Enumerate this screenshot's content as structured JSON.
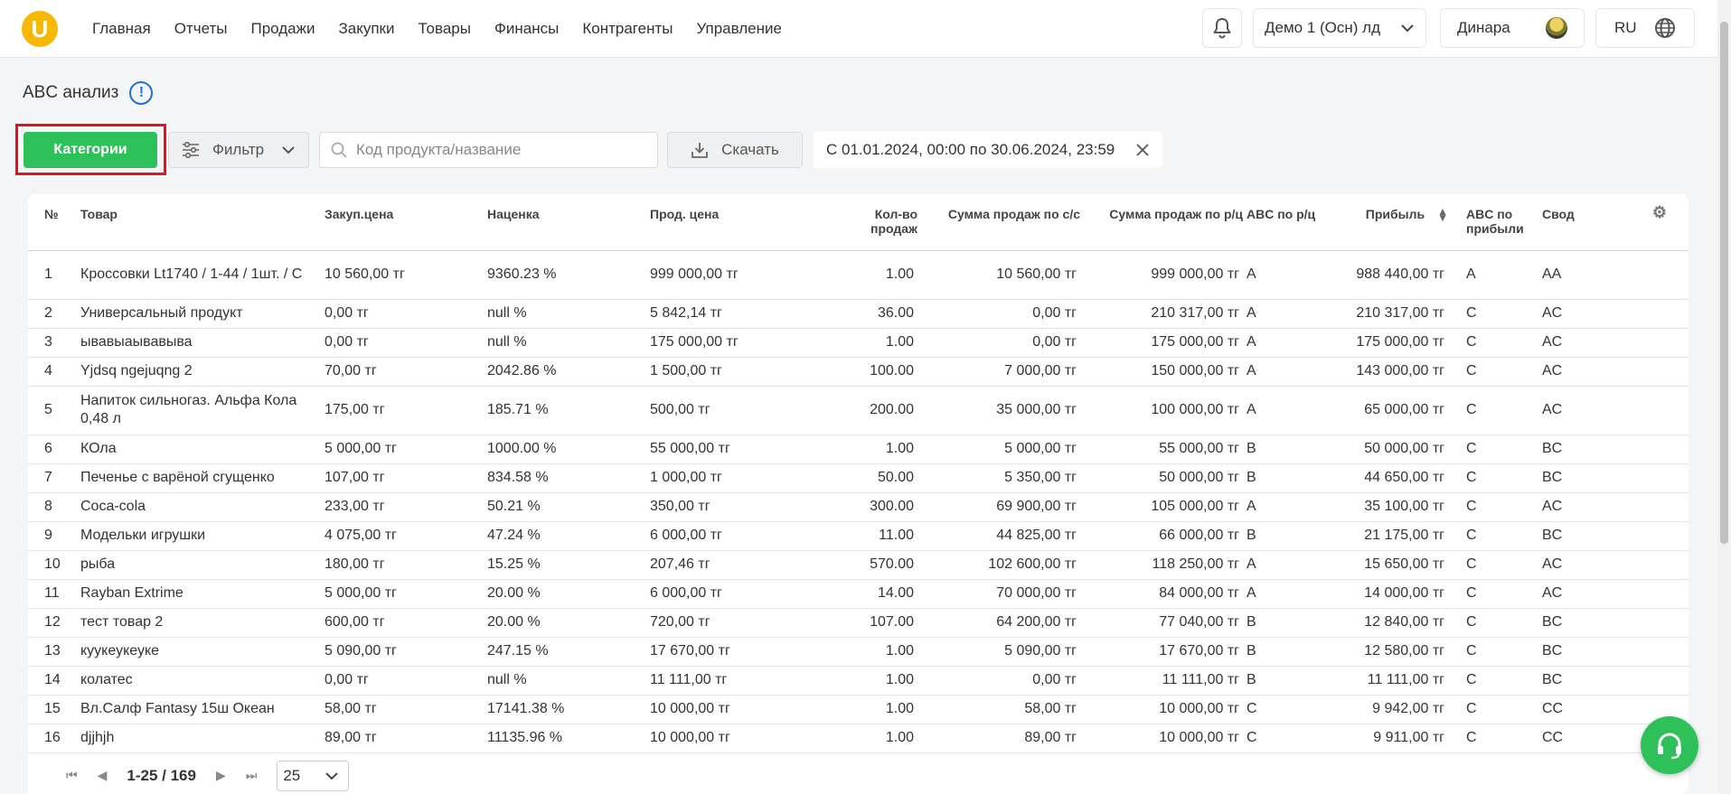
{
  "header": {
    "logo_letter": "U",
    "nav": [
      "Главная",
      "Отчеты",
      "Продажи",
      "Закупки",
      "Товары",
      "Финансы",
      "Контрагенты",
      "Управление"
    ],
    "org_selector": "Демо 1 (Осн) лд",
    "user_name": "Динара",
    "language": "RU"
  },
  "page": {
    "title": "ABC анализ",
    "info_glyph": "!"
  },
  "toolbar": {
    "categories_label": "Категории",
    "filter_label": "Фильтр",
    "search_placeholder": "Код продукта/название",
    "search_value": "",
    "download_label": "Скачать",
    "date_range": "С 01.01.2024, 00:00 по 30.06.2024, 23:59"
  },
  "table": {
    "columns": [
      "№",
      "Товар",
      "Закуп.цена",
      "Наценка",
      "Прод. цена",
      "Кол-во продаж",
      "Сумма продаж по с/с",
      "Сумма продаж по р/ц",
      "ABC по р/ц",
      "Прибыль",
      "ABC по прибыли",
      "Свод"
    ],
    "rows": [
      [
        "1",
        "Кроссовки Lt1740 / 1-44 / 1шт. / C",
        "10 560,00 тг",
        "9360.23 %",
        "999 000,00 тг",
        "1.00",
        "10 560,00 тг",
        "999 000,00 тг",
        "A",
        "988 440,00 тг",
        "A",
        "AA"
      ],
      [
        "2",
        "Универсальный продукт",
        "0,00 тг",
        "null %",
        "5 842,14 тг",
        "36.00",
        "0,00 тг",
        "210 317,00 тг",
        "A",
        "210 317,00 тг",
        "C",
        "AC"
      ],
      [
        "3",
        "ывавыаывавыва",
        "0,00 тг",
        "null %",
        "175 000,00 тг",
        "1.00",
        "0,00 тг",
        "175 000,00 тг",
        "A",
        "175 000,00 тг",
        "C",
        "AC"
      ],
      [
        "4",
        "Yjdsq ngejuqng 2",
        "70,00 тг",
        "2042.86 %",
        "1 500,00 тг",
        "100.00",
        "7 000,00 тг",
        "150 000,00 тг",
        "A",
        "143 000,00 тг",
        "C",
        "AC"
      ],
      [
        "5",
        "Напиток сильногаз. Альфа Кола 0,48 л",
        "175,00 тг",
        "185.71 %",
        "500,00 тг",
        "200.00",
        "35 000,00 тг",
        "100 000,00 тг",
        "A",
        "65 000,00 тг",
        "C",
        "AC"
      ],
      [
        "6",
        "КОла",
        "5 000,00 тг",
        "1000.00 %",
        "55 000,00 тг",
        "1.00",
        "5 000,00 тг",
        "55 000,00 тг",
        "B",
        "50 000,00 тг",
        "C",
        "BC"
      ],
      [
        "7",
        "Печенье с варёной сгущенко",
        "107,00 тг",
        "834.58 %",
        "1 000,00 тг",
        "50.00",
        "5 350,00 тг",
        "50 000,00 тг",
        "B",
        "44 650,00 тг",
        "C",
        "BC"
      ],
      [
        "8",
        "Coca-cola",
        "233,00 тг",
        "50.21 %",
        "350,00 тг",
        "300.00",
        "69 900,00 тг",
        "105 000,00 тг",
        "A",
        "35 100,00 тг",
        "C",
        "AC"
      ],
      [
        "9",
        "Модельки игрушки",
        "4 075,00 тг",
        "47.24 %",
        "6 000,00 тг",
        "11.00",
        "44 825,00 тг",
        "66 000,00 тг",
        "B",
        "21 175,00 тг",
        "C",
        "BC"
      ],
      [
        "10",
        "рыба",
        "180,00 тг",
        "15.25 %",
        "207,46 тг",
        "570.00",
        "102 600,00 тг",
        "118 250,00 тг",
        "A",
        "15 650,00 тг",
        "C",
        "AC"
      ],
      [
        "11",
        "Rayban Extrime",
        "5 000,00 тг",
        "20.00 %",
        "6 000,00 тг",
        "14.00",
        "70 000,00 тг",
        "84 000,00 тг",
        "A",
        "14 000,00 тг",
        "C",
        "AC"
      ],
      [
        "12",
        "тест товар 2",
        "600,00 тг",
        "20.00 %",
        "720,00 тг",
        "107.00",
        "64 200,00 тг",
        "77 040,00 тг",
        "B",
        "12 840,00 тг",
        "C",
        "BC"
      ],
      [
        "13",
        "куукеукеуке",
        "5 090,00 тг",
        "247.15 %",
        "17 670,00 тг",
        "1.00",
        "5 090,00 тг",
        "17 670,00 тг",
        "B",
        "12 580,00 тг",
        "C",
        "BC"
      ],
      [
        "14",
        "колатес",
        "0,00 тг",
        "null %",
        "11 111,00 тг",
        "1.00",
        "0,00 тг",
        "11 111,00 тг",
        "B",
        "11 111,00 тг",
        "C",
        "BC"
      ],
      [
        "15",
        "Вл.Салф Fantasy 15ш Океан",
        "58,00 тг",
        "17141.38 %",
        "10 000,00 тг",
        "1.00",
        "58,00 тг",
        "10 000,00 тг",
        "C",
        "9 942,00 тг",
        "C",
        "CC"
      ],
      [
        "16",
        "djjhjh",
        "89,00 тг",
        "11135.96 %",
        "10 000,00 тг",
        "1.00",
        "89,00 тг",
        "10 000,00 тг",
        "C",
        "9 911,00 тг",
        "C",
        "CC"
      ]
    ]
  },
  "pagination": {
    "range": "1-25 / 169",
    "page_size": "25"
  },
  "colors": {
    "accent_green": "#2ec15a",
    "highlight_red": "#e0141e",
    "logo_yellow": "#f6b800",
    "info_blue": "#1e6fd9"
  }
}
